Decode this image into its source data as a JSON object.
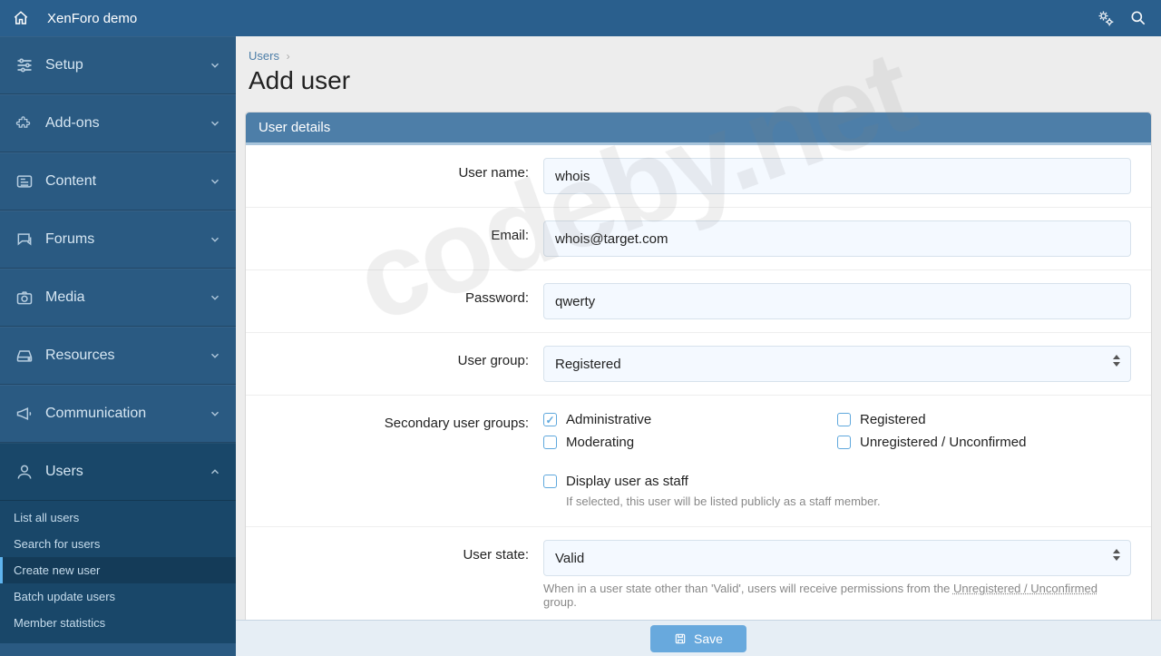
{
  "topbar": {
    "title": "XenForo demo"
  },
  "sidebar": {
    "items": [
      {
        "label": "Setup",
        "icon": "sliders"
      },
      {
        "label": "Add-ons",
        "icon": "puzzle"
      },
      {
        "label": "Content",
        "icon": "newspaper"
      },
      {
        "label": "Forums",
        "icon": "chat"
      },
      {
        "label": "Media",
        "icon": "camera"
      },
      {
        "label": "Resources",
        "icon": "drive"
      },
      {
        "label": "Communication",
        "icon": "megaphone"
      },
      {
        "label": "Users",
        "icon": "user"
      }
    ],
    "sub": [
      "List all users",
      "Search for users",
      "Create new user",
      "Batch update users",
      "Member statistics"
    ]
  },
  "breadcrumb": {
    "root": "Users"
  },
  "page": {
    "title": "Add user"
  },
  "panel": {
    "title": "User details"
  },
  "form": {
    "username_label": "User name:",
    "username_value": "whois",
    "email_label": "Email:",
    "email_value": "whois@target.com",
    "password_label": "Password:",
    "password_value": "qwerty",
    "usergroup_label": "User group:",
    "usergroup_value": "Registered",
    "secondary_label": "Secondary user groups:",
    "secondary_groups": {
      "administrative": "Administrative",
      "moderating": "Moderating",
      "registered": "Registered",
      "unregistered": "Unregistered / Unconfirmed"
    },
    "display_staff_label": "Display user as staff",
    "display_staff_hint": "If selected, this user will be listed publicly as a staff member.",
    "userstate_label": "User state:",
    "userstate_value": "Valid",
    "userstate_note_a": "When in a user state other than 'Valid', users will receive permissions from the ",
    "userstate_note_link": "Unregistered / Unconfirmed",
    "userstate_note_b": " group."
  },
  "save": {
    "label": "Save"
  },
  "watermark": "codeby.net"
}
